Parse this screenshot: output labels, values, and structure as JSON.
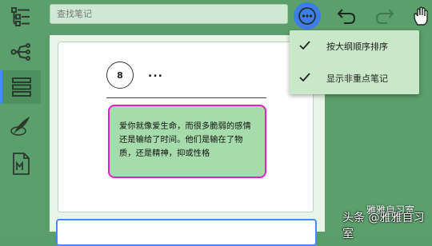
{
  "search": {
    "placeholder": "查找笔记"
  },
  "sidebar": {
    "items": [
      {
        "name": "outline-tree"
      },
      {
        "name": "mindmap"
      },
      {
        "name": "list-view",
        "active": true
      },
      {
        "name": "feather"
      },
      {
        "name": "markdown"
      }
    ]
  },
  "note": {
    "number": "8",
    "ellipsis": "...",
    "text": "爱你就像爱生命，而很多脆弱的感情还是输给了时间。他们是输在了物质，还是精神，抑或性格"
  },
  "menu": {
    "items": [
      {
        "label": "按大纲顺序排序",
        "checked": true
      },
      {
        "label": "显示非重点笔记",
        "checked": true
      }
    ]
  },
  "watermark": {
    "text": "头条 @雅雅自习室",
    "top_text": "雅雅自习室"
  },
  "colors": {
    "accent": "#3f7de6",
    "highlight_border": "#e020c8",
    "note_fill": "#a6dcab"
  }
}
